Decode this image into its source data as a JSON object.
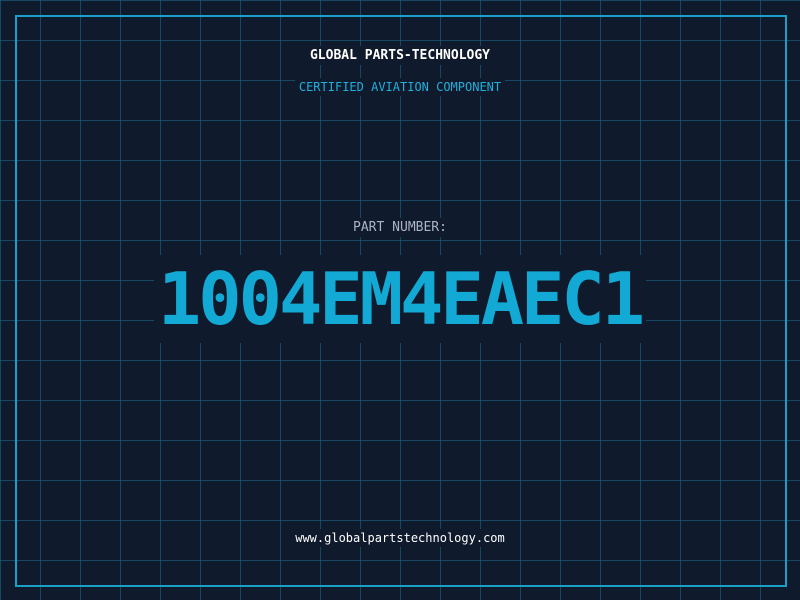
{
  "header": {
    "company": "GLOBAL PARTS-TECHNOLOGY",
    "subtitle": "CERTIFIED AVIATION COMPONENT"
  },
  "part": {
    "label": "PART NUMBER:",
    "number": "1004EM4EAEC1"
  },
  "footer": {
    "url": "www.globalpartstechnology.com"
  },
  "colors": {
    "background": "#101a2d",
    "grid": "#1a6e8c",
    "accent": "#12a9d4",
    "frame": "#1aa0c8"
  }
}
